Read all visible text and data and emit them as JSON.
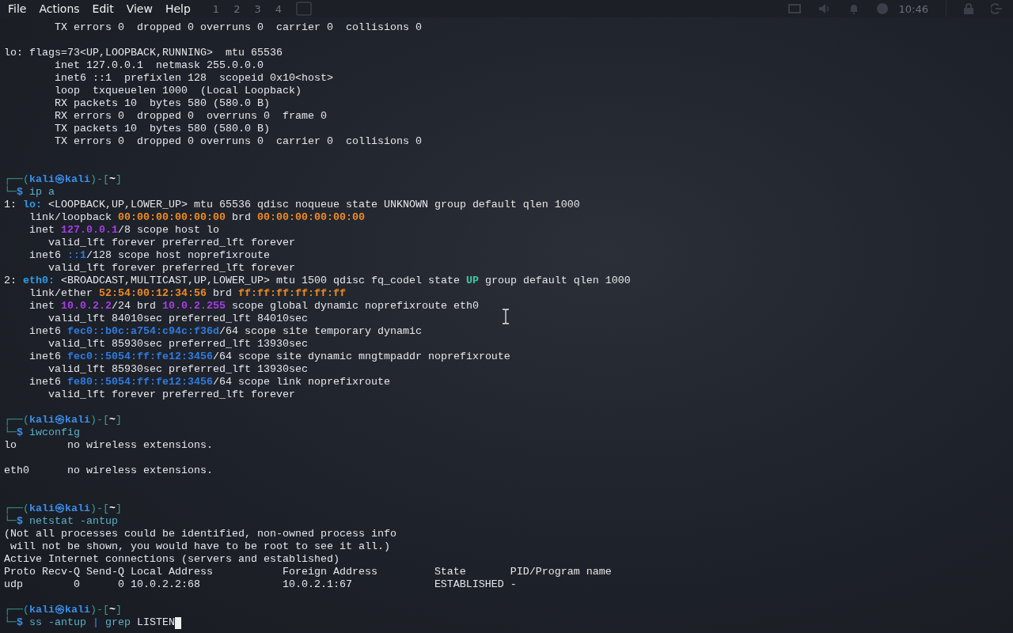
{
  "menu": [
    {
      "label": "File"
    },
    {
      "label": "Actions"
    },
    {
      "label": "Edit"
    },
    {
      "label": "View"
    },
    {
      "label": "Help"
    }
  ],
  "panel": {
    "workspaces": [
      "1",
      "2",
      "3",
      "4"
    ],
    "clock": "10:46"
  },
  "lines": [
    {
      "kind": "text",
      "parts": [
        {
          "kind": "plain",
          "text": "        TX errors 0  dropped 0 overruns 0  carrier 0  collisions 0"
        }
      ]
    },
    {
      "kind": "blank"
    },
    {
      "kind": "text",
      "parts": [
        {
          "kind": "plain",
          "text": "lo: flags=73<UP,LOOPBACK,RUNNING>  mtu 65536"
        }
      ]
    },
    {
      "kind": "text",
      "parts": [
        {
          "kind": "plain",
          "text": "        inet 127.0.0.1  netmask 255.0.0.0"
        }
      ]
    },
    {
      "kind": "text",
      "parts": [
        {
          "kind": "plain",
          "text": "        inet6 ::1  prefixlen 128  scopeid 0x10<host>"
        }
      ]
    },
    {
      "kind": "text",
      "parts": [
        {
          "kind": "plain",
          "text": "        loop  txqueuelen 1000  (Local Loopback)"
        }
      ]
    },
    {
      "kind": "text",
      "parts": [
        {
          "kind": "plain",
          "text": "        RX packets 10  bytes 580 (580.0 B)"
        }
      ]
    },
    {
      "kind": "text",
      "parts": [
        {
          "kind": "plain",
          "text": "        RX errors 0  dropped 0  overruns 0  frame 0"
        }
      ]
    },
    {
      "kind": "text",
      "parts": [
        {
          "kind": "plain",
          "text": "        TX packets 10  bytes 580 (580.0 B)"
        }
      ]
    },
    {
      "kind": "text",
      "parts": [
        {
          "kind": "plain",
          "text": "        TX errors 0  dropped 0 overruns 0  carrier 0  collisions 0"
        }
      ]
    },
    {
      "kind": "blank"
    },
    {
      "kind": "blank"
    },
    {
      "kind": "prompt",
      "parts": [
        {
          "kind": "frame",
          "text": "┌──("
        },
        {
          "kind": "user",
          "text": "kali㉿kali"
        },
        {
          "kind": "frame",
          "text": ")-["
        },
        {
          "kind": "dir",
          "text": "~"
        },
        {
          "kind": "frame",
          "text": "]"
        }
      ]
    },
    {
      "kind": "command",
      "parts": [
        {
          "kind": "frame",
          "text": "└─"
        },
        {
          "kind": "dollar",
          "text": "$"
        },
        {
          "kind": "cmd",
          "text": " ip a"
        }
      ]
    },
    {
      "kind": "text",
      "parts": [
        {
          "kind": "plain",
          "text": "1: "
        },
        {
          "kind": "iface",
          "text": "lo:"
        },
        {
          "kind": "plain",
          "text": " <LOOPBACK,UP,LOWER_UP> mtu 65536 qdisc noqueue state UNKNOWN group default qlen 1000"
        }
      ]
    },
    {
      "kind": "text",
      "parts": [
        {
          "kind": "plain",
          "text": "    link/loopback "
        },
        {
          "kind": "mac",
          "text": "00:00:00:00:00:00"
        },
        {
          "kind": "plain",
          "text": " brd "
        },
        {
          "kind": "mac",
          "text": "00:00:00:00:00:00"
        }
      ]
    },
    {
      "kind": "text",
      "parts": [
        {
          "kind": "plain",
          "text": "    inet "
        },
        {
          "kind": "ip4",
          "text": "127.0.0.1"
        },
        {
          "kind": "plain",
          "text": "/8 scope host lo"
        }
      ]
    },
    {
      "kind": "text",
      "parts": [
        {
          "kind": "plain",
          "text": "       valid_lft forever preferred_lft forever"
        }
      ]
    },
    {
      "kind": "text",
      "parts": [
        {
          "kind": "plain",
          "text": "    inet6 "
        },
        {
          "kind": "ip6",
          "text": "::1"
        },
        {
          "kind": "plain",
          "text": "/128 scope host noprefixroute"
        }
      ]
    },
    {
      "kind": "text",
      "parts": [
        {
          "kind": "plain",
          "text": "       valid_lft forever preferred_lft forever"
        }
      ]
    },
    {
      "kind": "text",
      "parts": [
        {
          "kind": "plain",
          "text": "2: "
        },
        {
          "kind": "iface",
          "text": "eth0:"
        },
        {
          "kind": "plain",
          "text": " <BROADCAST,MULTICAST,UP,LOWER_UP> mtu 1500 qdisc fq_codel state "
        },
        {
          "kind": "up",
          "text": "UP"
        },
        {
          "kind": "plain",
          "text": " group default qlen 1000"
        }
      ]
    },
    {
      "kind": "text",
      "parts": [
        {
          "kind": "plain",
          "text": "    link/ether "
        },
        {
          "kind": "mac",
          "text": "52:54:00:12:34:56"
        },
        {
          "kind": "plain",
          "text": " brd "
        },
        {
          "kind": "mac",
          "text": "ff:ff:ff:ff:ff:ff"
        }
      ]
    },
    {
      "kind": "text",
      "parts": [
        {
          "kind": "plain",
          "text": "    inet "
        },
        {
          "kind": "ip4",
          "text": "10.0.2.2"
        },
        {
          "kind": "plain",
          "text": "/24 brd "
        },
        {
          "kind": "ip4",
          "text": "10.0.2.255"
        },
        {
          "kind": "plain",
          "text": " scope global dynamic noprefixroute eth0"
        }
      ]
    },
    {
      "kind": "text",
      "parts": [
        {
          "kind": "plain",
          "text": "       valid_lft 84010sec preferred_lft 84010sec"
        }
      ]
    },
    {
      "kind": "text",
      "parts": [
        {
          "kind": "plain",
          "text": "    inet6 "
        },
        {
          "kind": "ip6",
          "text": "fec0::b0c:a754:c94c:f36d"
        },
        {
          "kind": "plain",
          "text": "/64 scope site temporary dynamic"
        }
      ]
    },
    {
      "kind": "text",
      "parts": [
        {
          "kind": "plain",
          "text": "       valid_lft 85930sec preferred_lft 13930sec"
        }
      ]
    },
    {
      "kind": "text",
      "parts": [
        {
          "kind": "plain",
          "text": "    inet6 "
        },
        {
          "kind": "ip6",
          "text": "fec0::5054:ff:fe12:3456"
        },
        {
          "kind": "plain",
          "text": "/64 scope site dynamic mngtmpaddr noprefixroute"
        }
      ]
    },
    {
      "kind": "text",
      "parts": [
        {
          "kind": "plain",
          "text": "       valid_lft 85930sec preferred_lft 13930sec"
        }
      ]
    },
    {
      "kind": "text",
      "parts": [
        {
          "kind": "plain",
          "text": "    inet6 "
        },
        {
          "kind": "ip6",
          "text": "fe80::5054:ff:fe12:3456"
        },
        {
          "kind": "plain",
          "text": "/64 scope link noprefixroute"
        }
      ]
    },
    {
      "kind": "text",
      "parts": [
        {
          "kind": "plain",
          "text": "       valid_lft forever preferred_lft forever"
        }
      ]
    },
    {
      "kind": "blank"
    },
    {
      "kind": "prompt",
      "parts": [
        {
          "kind": "frame",
          "text": "┌──("
        },
        {
          "kind": "user",
          "text": "kali㉿kali"
        },
        {
          "kind": "frame",
          "text": ")-["
        },
        {
          "kind": "dir",
          "text": "~"
        },
        {
          "kind": "frame",
          "text": "]"
        }
      ]
    },
    {
      "kind": "command",
      "parts": [
        {
          "kind": "frame",
          "text": "└─"
        },
        {
          "kind": "dollar",
          "text": "$"
        },
        {
          "kind": "cmd",
          "text": " iwconfig"
        }
      ]
    },
    {
      "kind": "text",
      "parts": [
        {
          "kind": "plain",
          "text": "lo        no wireless extensions."
        }
      ]
    },
    {
      "kind": "blank"
    },
    {
      "kind": "text",
      "parts": [
        {
          "kind": "plain",
          "text": "eth0      no wireless extensions."
        }
      ]
    },
    {
      "kind": "blank"
    },
    {
      "kind": "blank"
    },
    {
      "kind": "prompt",
      "parts": [
        {
          "kind": "frame",
          "text": "┌──("
        },
        {
          "kind": "user",
          "text": "kali㉿kali"
        },
        {
          "kind": "frame",
          "text": ")-["
        },
        {
          "kind": "dir",
          "text": "~"
        },
        {
          "kind": "frame",
          "text": "]"
        }
      ]
    },
    {
      "kind": "command",
      "parts": [
        {
          "kind": "frame",
          "text": "└─"
        },
        {
          "kind": "dollar",
          "text": "$"
        },
        {
          "kind": "cmd",
          "text": " netstat -antup"
        }
      ]
    },
    {
      "kind": "text",
      "parts": [
        {
          "kind": "plain",
          "text": "(Not all processes could be identified, non-owned process info"
        }
      ]
    },
    {
      "kind": "text",
      "parts": [
        {
          "kind": "plain",
          "text": " will not be shown, you would have to be root to see it all.)"
        }
      ]
    },
    {
      "kind": "text",
      "parts": [
        {
          "kind": "plain",
          "text": "Active Internet connections (servers and established)"
        }
      ]
    },
    {
      "kind": "text",
      "parts": [
        {
          "kind": "plain",
          "text": "Proto Recv-Q Send-Q Local Address           Foreign Address         State       PID/Program name"
        }
      ]
    },
    {
      "kind": "text",
      "parts": [
        {
          "kind": "plain",
          "text": "udp        0      0 10.0.2.2:68             10.0.2.1:67             ESTABLISHED -"
        }
      ]
    },
    {
      "kind": "blank"
    },
    {
      "kind": "prompt",
      "parts": [
        {
          "kind": "frame",
          "text": "┌──("
        },
        {
          "kind": "user",
          "text": "kali㉿kali"
        },
        {
          "kind": "frame",
          "text": ")-["
        },
        {
          "kind": "dir",
          "text": "~"
        },
        {
          "kind": "frame",
          "text": "]"
        }
      ]
    },
    {
      "kind": "input",
      "parts": [
        {
          "kind": "frame",
          "text": "└─"
        },
        {
          "kind": "dollar",
          "text": "$"
        },
        {
          "kind": "cmd",
          "text": " ss -antup "
        },
        {
          "kind": "pipe",
          "text": "|"
        },
        {
          "kind": "cmd",
          "text": " grep "
        },
        {
          "kind": "arg",
          "text": "LISTEN"
        }
      ]
    }
  ]
}
